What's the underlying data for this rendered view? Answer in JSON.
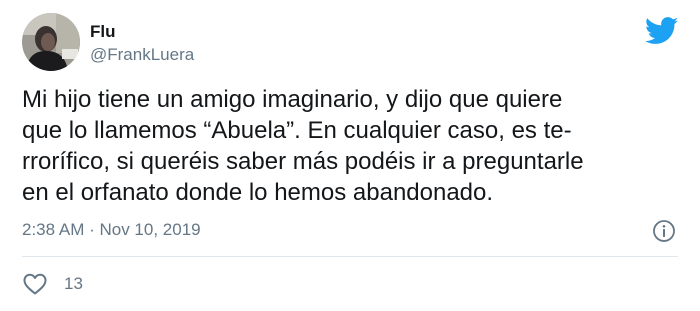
{
  "tweet": {
    "author": {
      "display_name": "Flu",
      "handle": "@FrankLuera"
    },
    "text": "Mi hijo tiene un amigo imaginario, y dijo que quiere\nque lo llamemos “Abuela”. En cualquier caso, es te-\nrrorífico, si queréis saber más podéis ir a preguntarle\nen el orfanato donde lo hemos abandonado.",
    "timestamp": "2:38 AM · Nov 10, 2019",
    "likes": "13",
    "icons": {
      "logo": "twitter-bird-icon",
      "info": "info-icon",
      "like": "heart-outline-icon"
    },
    "colors": {
      "brand": "#1da1f2",
      "text": "#14171a",
      "secondary": "#657786",
      "divider": "#e1e8ed"
    }
  }
}
